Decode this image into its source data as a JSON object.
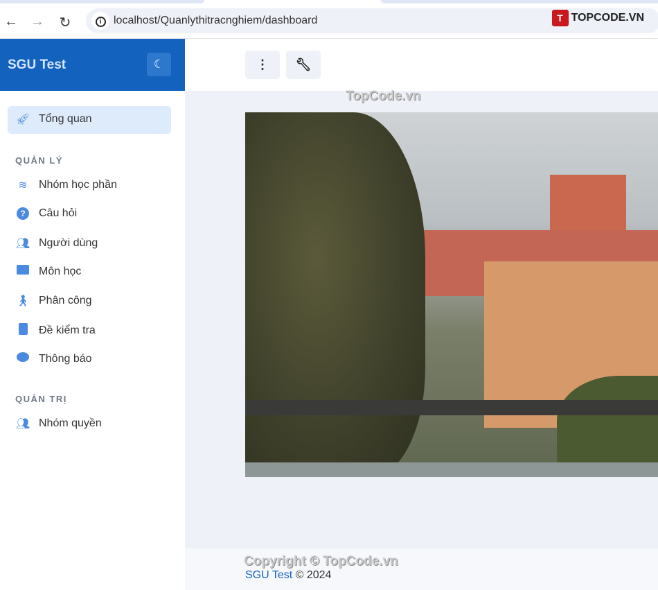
{
  "browser": {
    "url": "localhost/Quanlythitracnghiem/dashboard",
    "logo_text": "TOPCODE.VN"
  },
  "sidebar": {
    "brand": "SGU Test",
    "active_item": "Tổng quan",
    "sections": [
      {
        "title": "QUẢN LÝ",
        "items": [
          {
            "label": "Nhóm học phần",
            "icon": "layers-icon"
          },
          {
            "label": "Câu hỏi",
            "icon": "question-circle-icon"
          },
          {
            "label": "Người dùng",
            "icon": "users-icon"
          },
          {
            "label": "Môn học",
            "icon": "folder-icon"
          },
          {
            "label": "Phân công",
            "icon": "assign-icon"
          },
          {
            "label": "Đề kiểm tra",
            "icon": "file-icon"
          },
          {
            "label": "Thông báo",
            "icon": "comment-icon"
          }
        ]
      },
      {
        "title": "QUẢN TRỊ",
        "items": [
          {
            "label": "Nhóm quyền",
            "icon": "users-cog-icon"
          }
        ]
      }
    ]
  },
  "watermarks": {
    "center": "TopCode.vn",
    "footer": "Copyright © TopCode.vn"
  },
  "footer": {
    "brand": "SGU Test",
    "copyright": "© 2024"
  },
  "colors": {
    "brand": "#1262be",
    "accent": "#4a8ae0"
  }
}
